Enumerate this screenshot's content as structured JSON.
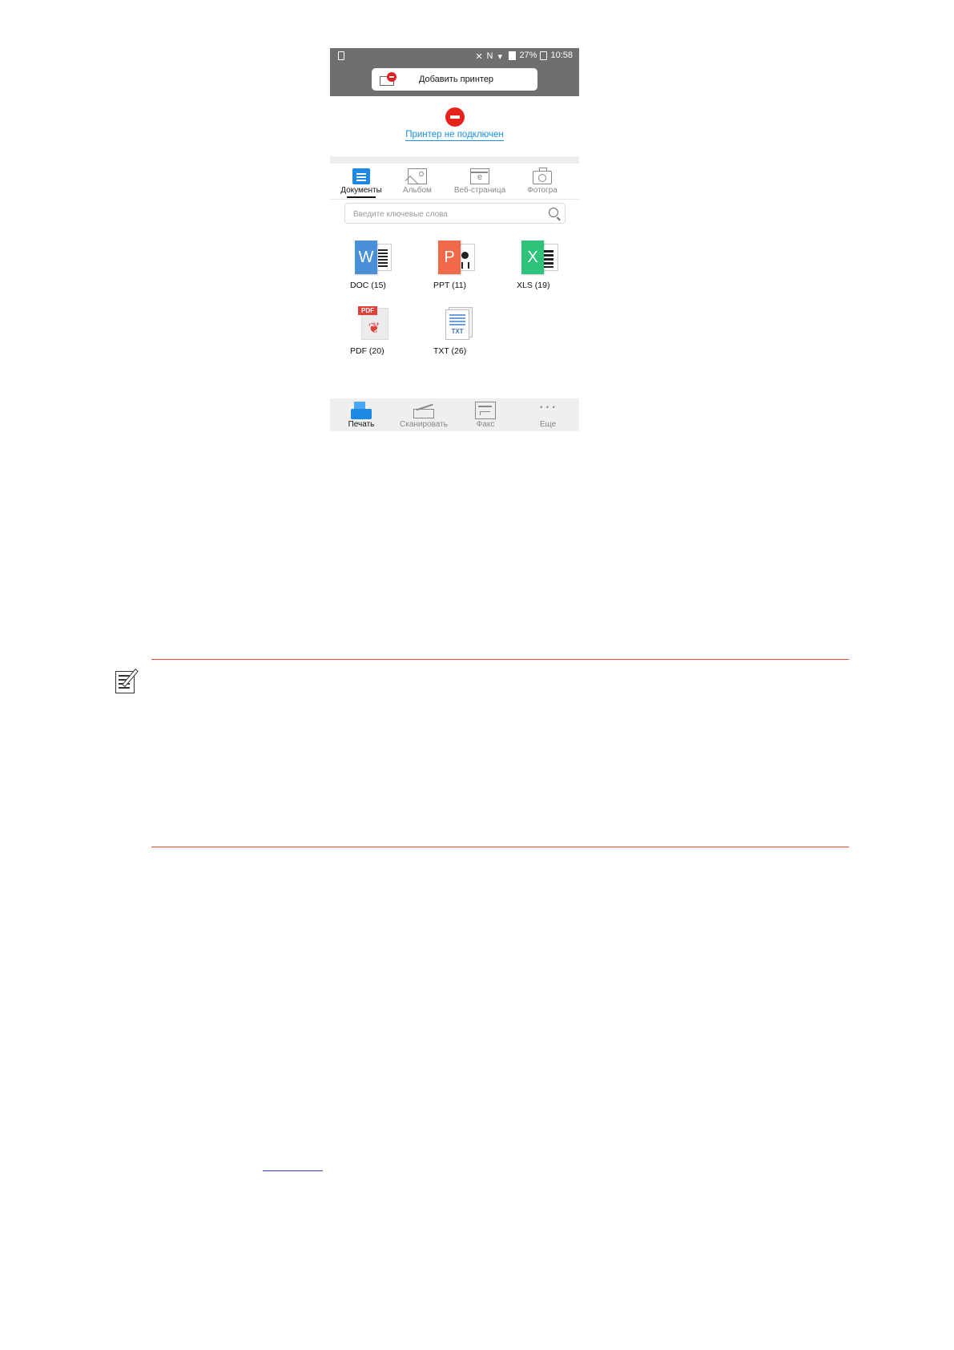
{
  "status_bar": {
    "battery": "27%",
    "time": "10:58"
  },
  "header": {
    "add_printer_label": "Добавить принтер"
  },
  "connection": {
    "status_text": "Принтер не подключен"
  },
  "tabs": [
    {
      "label": "Документы",
      "icon": "document-icon",
      "active": true
    },
    {
      "label": "Альбом",
      "icon": "image-icon",
      "active": false
    },
    {
      "label": "Веб-страница",
      "icon": "web-page-icon",
      "active": false
    },
    {
      "label": "Фотогра",
      "icon": "camera-icon",
      "active": false
    }
  ],
  "search": {
    "placeholder": "Введите ключевые слова",
    "value": ""
  },
  "files": [
    {
      "label": "DOC (15)",
      "glyph": "W",
      "icon": "word-file-icon"
    },
    {
      "label": "PPT (11)",
      "glyph": "P",
      "icon": "powerpoint-file-icon"
    },
    {
      "label": "XLS (19)",
      "glyph": "X",
      "icon": "excel-file-icon"
    },
    {
      "label": "PDF (20)",
      "tag": "PDF",
      "icon": "pdf-file-icon"
    },
    {
      "label": "TXT (26)",
      "tag": "TXT",
      "icon": "text-file-icon"
    }
  ],
  "bottom_nav": [
    {
      "label": "Печать",
      "icon": "print-icon",
      "active": true
    },
    {
      "label": "Сканировать",
      "icon": "scanner-icon",
      "active": false
    },
    {
      "label": "Факс",
      "icon": "fax-icon",
      "active": false
    },
    {
      "label": "Еще",
      "icon": "more-dots-icon",
      "active": false
    }
  ],
  "colors": {
    "accent_blue": "#1e88e5",
    "link_blue": "#1890e8",
    "error_red": "#e8231e",
    "note_rule_red": "#e8462e"
  }
}
